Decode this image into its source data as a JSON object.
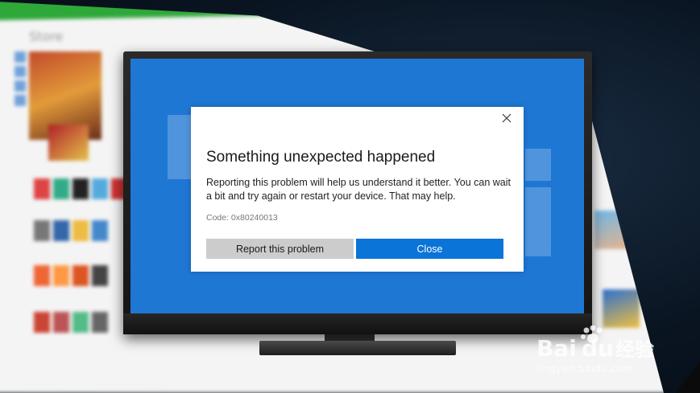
{
  "background": {
    "store_label": "Store"
  },
  "dialog": {
    "title": "Something unexpected happened",
    "message": "Reporting this problem will help us understand it better. You can wait a bit and try again or restart your device. That may help.",
    "code": "Code: 0x80240013",
    "report_label": "Report this problem",
    "close_label": "Close",
    "close_icon": "close-icon"
  },
  "watermark": {
    "brand": "Baidu经验",
    "url": "jingyan.baidu.com"
  },
  "colors": {
    "screen_blue": "#1f77d4",
    "primary_button": "#0a74d8",
    "secondary_button": "#cccccc",
    "store_green": "#2fa83a"
  }
}
